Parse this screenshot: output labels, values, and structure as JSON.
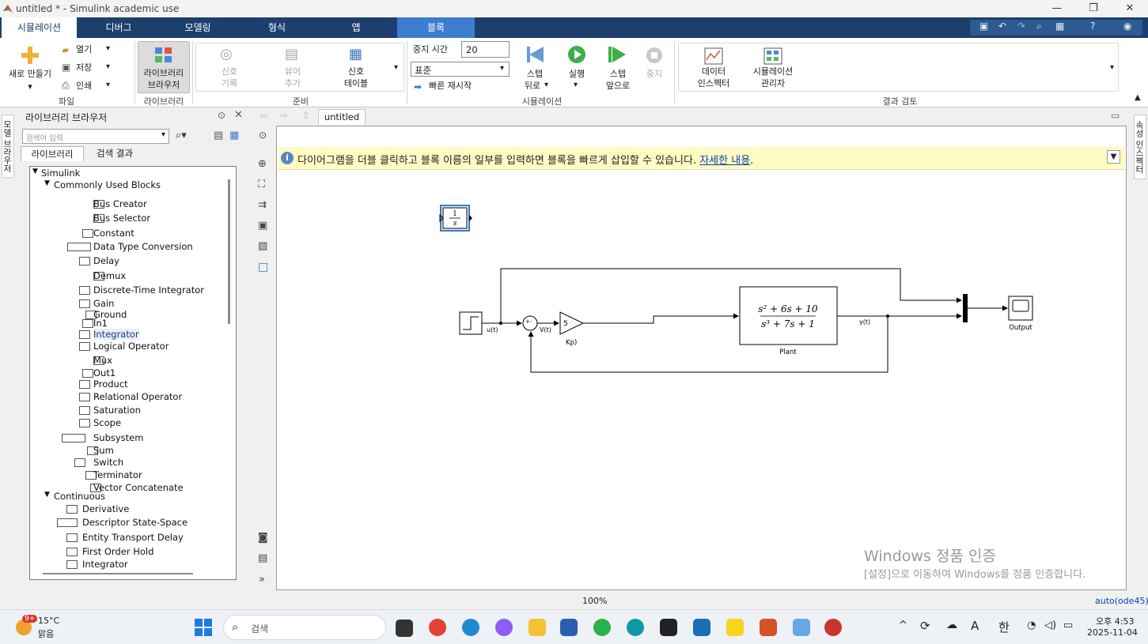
{
  "window": {
    "title": "untitled * - Simulink academic use"
  },
  "tabs": [
    "시뮬레이션",
    "디버그",
    "모델링",
    "형식",
    "앱",
    "블록"
  ],
  "ribbon": {
    "new_label": "새로 만들기",
    "open_label": "열기",
    "save_label": "저장",
    "print_label": "인쇄",
    "file_group": "파일",
    "library_browser_label": [
      "라이브러리",
      "브라우저"
    ],
    "library_group": "라이브러리",
    "signal_record": [
      "신호",
      "기록"
    ],
    "add_viewer": [
      "뷰어",
      "추가"
    ],
    "signal_table": [
      "신호",
      "테이블"
    ],
    "prepare_group": "준비",
    "stop_time_label": "중지 시간",
    "stop_time_value": "20",
    "sim_mode": "표준",
    "fast_restart": "빠른 재시작",
    "step_back": [
      "스텝",
      "뒤로"
    ],
    "run": "실행",
    "step_forward": [
      "스텝",
      "앞으로"
    ],
    "stop": "중지",
    "simulation_group": "시뮬레이션",
    "data_inspector": [
      "데이터",
      "인스펙터"
    ],
    "sim_manager": [
      "시뮬레이션",
      "관리자"
    ],
    "review_group": "결과 검토"
  },
  "library": {
    "title": "라이브러리 브라우저",
    "search_placeholder": "검색어 입력",
    "tab_library": "라이브러리",
    "tab_results": "검색 결과",
    "root": "Simulink",
    "group1": "Commonly Used Blocks",
    "items1": [
      "Bus Creator",
      "Bus Selector",
      "Constant",
      "Data Type Conversion",
      "Delay",
      "Demux",
      "Discrete-Time Integrator",
      "Gain",
      "Ground",
      "In1",
      "Integrator",
      "Logical Operator",
      "Mux",
      "Out1",
      "Product",
      "Relational Operator",
      "Saturation",
      "Scope",
      "Subsystem",
      "Sum",
      "Switch",
      "Terminator",
      "Vector Concatenate"
    ],
    "group2": "Continuous",
    "items2": [
      "Derivative",
      "Descriptor State-Space",
      "Entity Transport Delay",
      "First Order Hold",
      "Integrator"
    ]
  },
  "left_strip_label": "모델 브라우저",
  "right_strip_label": "속성 인스펙터",
  "editor": {
    "tab": "untitled",
    "address": "untitled",
    "info_text": "다이어그램을 더블 클릭하고 블록 이름의 일부를 입력하면 블록을 빠르게 삽입할 수 있습니다.",
    "info_link": "자세한 내용",
    "info_period": "."
  },
  "diagram": {
    "integrator_num": "1",
    "integrator_den": "s",
    "u_label": "u(t)",
    "v_label": "V(t)",
    "gain_value": "5",
    "gain_name": "Kp)",
    "plant_num": "s² + 6s + 10",
    "plant_den": "s³ + 7s + 1",
    "plant_name": "Plant",
    "y_label": "y(t)",
    "scope_name": "Output",
    "sum_signs": "+-"
  },
  "watermark": {
    "line1": "Windows 정품 인증",
    "line2": "[설정]으로 이동하여 Windows를 정품 인증합니다."
  },
  "status": {
    "zoom": "100%",
    "solver": "auto(ode45)"
  },
  "taskbar": {
    "temp": "15°C",
    "weather": "맑음",
    "badge": "9+",
    "search": "검색",
    "time": "오후 4:53",
    "date": "2025-11-04",
    "ime": "한",
    "lang": "A"
  },
  "colors": {
    "ribbon_tab_bg": "#1c3f6e",
    "active_block_tab": "#3c7dcf",
    "info_bg": "#fffbc5",
    "link": "#0645ad"
  }
}
